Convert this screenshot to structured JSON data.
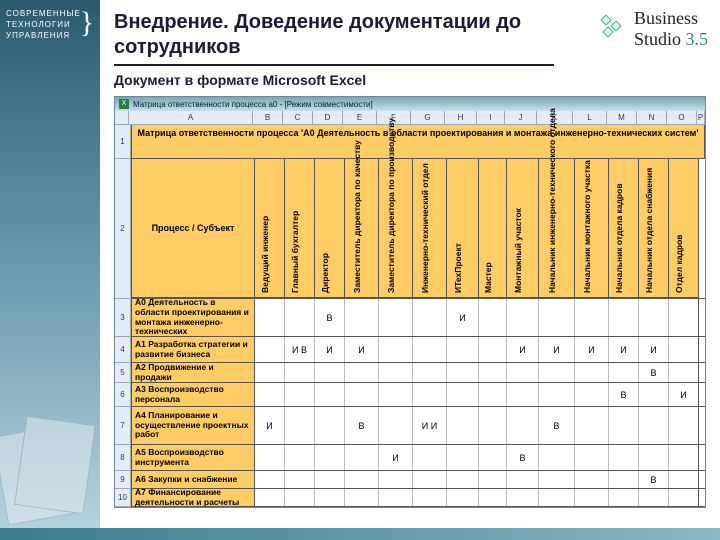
{
  "sidebar": {
    "company": "СОВРЕМЕННЫЕ\nТЕХНОЛОГИИ\nУПРАВЛЕНИЯ"
  },
  "brand": {
    "name": "Business",
    "product": "Studio",
    "version": "3.5"
  },
  "title": "Внедрение. Доведение документации до сотрудников",
  "subtitle": "Документ в формате Microsoft Excel",
  "excel": {
    "titlebar": "Матрица ответственности процесса а0 - [Режим совместимости]",
    "columns": [
      "A",
      "B",
      "C",
      "D",
      "E",
      "F",
      "G",
      "H",
      "I",
      "J",
      "K",
      "L",
      "M",
      "N",
      "O",
      "P"
    ],
    "row_numbers": [
      "1",
      "2",
      "3",
      "4",
      "5",
      "6",
      "7",
      "8",
      "9",
      "10"
    ],
    "matrix_title": "Матрица ответственности процесса 'A0 Деятельность в области проектирования и монтажа инженерно-технических систем'",
    "proc_label": "Процесс / Субъект",
    "roles": [
      "Ведущий инженер",
      "Главный бухгалтер",
      "Директор",
      "Заместитель директора по качеству",
      "Заместитель директора по производству",
      "Инженерно-технический отдел",
      "ИТехПроект",
      "Мастер",
      "Монтажный участок",
      "Начальник инженерно-технического отдела",
      "Начальник монтажного участка",
      "Начальник отдела кадров",
      "Начальник отдела снабжения",
      "Отдел кадров"
    ],
    "rows": [
      {
        "proc": "A0 Деятельность в области проектирования и монтажа инженерно-технических",
        "vals": [
          "",
          "",
          "В",
          "",
          "",
          "",
          "И",
          "",
          "",
          "",
          "",
          "",
          "",
          ""
        ]
      },
      {
        "proc": "A1 Разработка стратегии и развитие бизнеса",
        "vals": [
          "",
          "И В",
          "И",
          "И",
          "",
          "",
          "",
          "",
          "И",
          "И",
          "И",
          "И",
          "И",
          ""
        ]
      },
      {
        "proc": "A2 Продвижение и продажи",
        "vals": [
          "",
          "",
          "",
          "",
          "",
          "",
          "",
          "",
          "",
          "",
          "",
          "",
          "В",
          ""
        ]
      },
      {
        "proc": "A3 Воспроизводство персонала",
        "vals": [
          "",
          "",
          "",
          "",
          "",
          "",
          "",
          "",
          "",
          "",
          "",
          "В",
          "",
          "И"
        ]
      },
      {
        "proc": "A4 Планирование и осуществление проектных работ",
        "vals": [
          "И",
          "",
          "",
          "В",
          "",
          "И И",
          "",
          "",
          "",
          "В",
          "",
          "",
          "",
          ""
        ]
      },
      {
        "proc": "A5 Воспроизводство инструмента",
        "vals": [
          "",
          "",
          "",
          "",
          "И",
          "",
          "",
          "",
          "В",
          "",
          "",
          "",
          "",
          ""
        ]
      },
      {
        "proc": "A6 Закупки и снабжение",
        "vals": [
          "",
          "",
          "",
          "",
          "",
          "",
          "",
          "",
          "",
          "",
          "",
          "",
          "В",
          ""
        ]
      },
      {
        "proc": "A7 Финансирование деятельности и расчеты",
        "vals": [
          "",
          "",
          "",
          "",
          "",
          "",
          "",
          "",
          "",
          "",
          "",
          "",
          "",
          ""
        ]
      }
    ]
  },
  "chart_data": {
    "type": "table",
    "title": "Матрица ответственности процесса 'A0 Деятельность в области проектирования и монтажа инженерно-технических систем'",
    "columns": [
      "Процесс / Субъект",
      "Ведущий инженер",
      "Главный бухгалтер",
      "Директор",
      "Заместитель директора по качеству",
      "Заместитель директора по производству",
      "Инженерно-технический отдел",
      "ИТехПроект",
      "Мастер",
      "Монтажный участок",
      "Начальник инженерно-технического отдела",
      "Начальник монтажного участка",
      "Начальник отдела кадров",
      "Начальник отдела снабжения",
      "Отдел кадров"
    ],
    "rows": [
      [
        "A0 Деятельность в области проектирования и монтажа инженерно-технических",
        "",
        "",
        "В",
        "",
        "",
        "",
        "И",
        "",
        "",
        "",
        "",
        "",
        "",
        ""
      ],
      [
        "A1 Разработка стратегии и развитие бизнеса",
        "",
        "И В",
        "И",
        "И",
        "",
        "",
        "",
        "",
        "И",
        "И",
        "И",
        "И",
        "И",
        ""
      ],
      [
        "A2 Продвижение и продажи",
        "",
        "",
        "",
        "",
        "",
        "",
        "",
        "",
        "",
        "",
        "",
        "",
        "В",
        ""
      ],
      [
        "A3 Воспроизводство персонала",
        "",
        "",
        "",
        "",
        "",
        "",
        "",
        "",
        "",
        "",
        "",
        "В",
        "",
        "И"
      ],
      [
        "A4 Планирование и осуществление проектных работ",
        "И",
        "",
        "",
        "В",
        "",
        "И И",
        "",
        "",
        "",
        "В",
        "",
        "",
        "",
        ""
      ],
      [
        "A5 Воспроизводство инструмента",
        "",
        "",
        "",
        "",
        "И",
        "",
        "",
        "",
        "В",
        "",
        "",
        "",
        "",
        ""
      ],
      [
        "A6 Закупки и снабжение",
        "",
        "",
        "",
        "",
        "",
        "",
        "",
        "",
        "",
        "",
        "",
        "",
        "В",
        ""
      ],
      [
        "A7 Финансирование деятельности и расчеты",
        "",
        "",
        "",
        "",
        "",
        "",
        "",
        "",
        "",
        "",
        "",
        "",
        "",
        ""
      ]
    ]
  }
}
